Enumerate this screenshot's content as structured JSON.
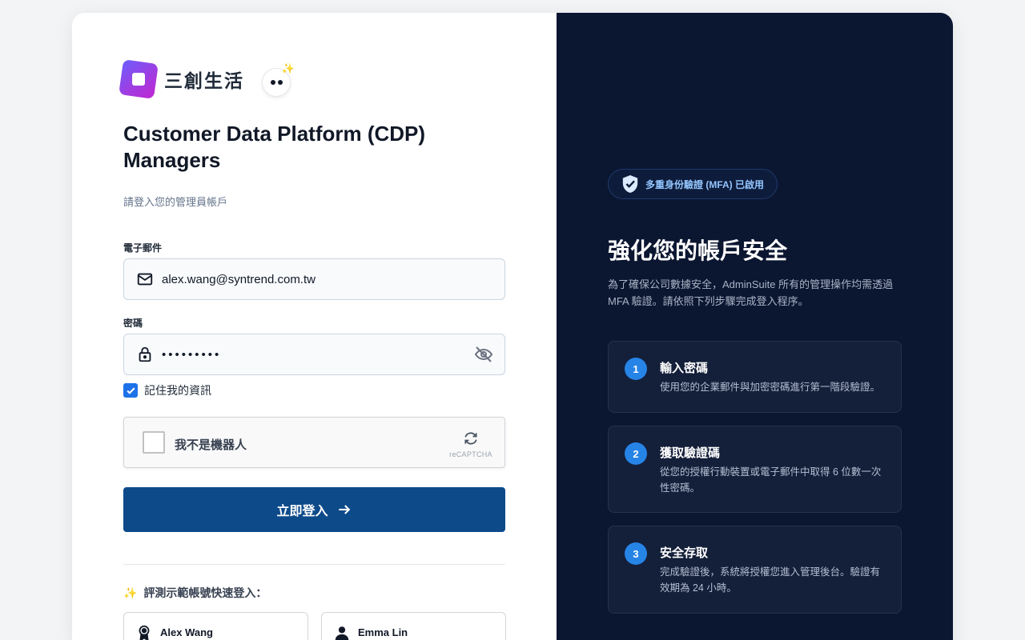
{
  "brand": {
    "logo_text": "三創生活",
    "mascot_sparkle": "✨"
  },
  "login": {
    "title": "Customer Data Platform (CDP) Managers",
    "subtitle": "請登入您的管理員帳戶",
    "email_label": "電子郵件",
    "email_value": "alex.wang@syntrend.com.tw",
    "password_label": "密碼",
    "password_masked": "•••••••••",
    "remember_label": "記住我的資訊",
    "remember_checked": true,
    "captcha_label": "我不是機器人",
    "captcha_brand": "reCAPTCHA",
    "submit_label": "立即登入",
    "quick_login_icon": "✨",
    "quick_login_title": "評測示範帳號快速登入：",
    "demo_accounts": [
      {
        "name": "Alex Wang",
        "icon": "badge-icon"
      },
      {
        "name": "Emma Lin",
        "icon": "user-icon"
      }
    ]
  },
  "security_panel": {
    "mfa_badge": "多重身份驗證 (MFA) 已啟用",
    "title": "強化您的帳戶安全",
    "description": "為了確保公司數據安全，AdminSuite 所有的管理操作均需透過 MFA 驗證。請依照下列步驟完成登入程序。",
    "steps": [
      {
        "number": "1",
        "title": "輸入密碼",
        "description": "使用您的企業郵件與加密密碼進行第一階段驗證。"
      },
      {
        "number": "2",
        "title": "獲取驗證碼",
        "description": "從您的授權行動裝置或電子郵件中取得 6 位數一次性密碼。"
      },
      {
        "number": "3",
        "title": "安全存取",
        "description": "完成驗證後，系統將授權您進入管理後台。驗證有效期為 24 小時。"
      }
    ]
  },
  "colors": {
    "primary_button": "#0d4a8a",
    "panel_bg": "#0b1631",
    "step_number": "#2684e6",
    "checkbox": "#1d72e8"
  }
}
